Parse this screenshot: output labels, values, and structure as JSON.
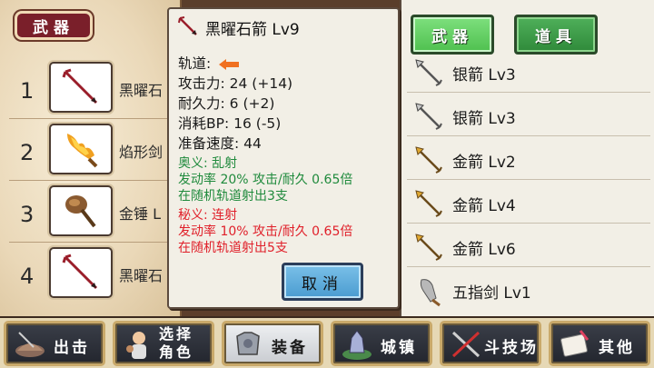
{
  "left_panel": {
    "tab_label": "武器",
    "slots": [
      {
        "number": "1",
        "name": "黑曜石",
        "icon": "obsidian-arrow-icon"
      },
      {
        "number": "2",
        "name": "焰形剑",
        "icon": "flame-sword-icon"
      },
      {
        "number": "3",
        "name": "金锤 L",
        "icon": "gold-hammer-icon"
      },
      {
        "number": "4",
        "name": "黑曜石",
        "icon": "obsidian-arrow-icon"
      }
    ]
  },
  "detail": {
    "title": "黑曜石箭 Lv9",
    "track_label": "轨道:",
    "stats": [
      "攻击力: 24 (+14)",
      "耐久力: 6 (+2)",
      "消耗BP: 16 (-5)",
      "准备速度: 44"
    ],
    "secret1": {
      "name": "奥义: 乱射",
      "rate": "发动率 20%  攻击/耐久 0.65倍",
      "desc": "在随机轨道射出3支"
    },
    "secret2": {
      "name": "秘义: 连射",
      "rate": "发动率 10%   攻击/耐久 0.65倍",
      "desc": "在随机轨道射出5支"
    },
    "cancel_label": "取消"
  },
  "right_panel": {
    "tabs": {
      "weapon": "武器",
      "item": "道具"
    },
    "items": [
      {
        "name": "银箭 Lv3",
        "icon": "silver-arrow-icon"
      },
      {
        "name": "银箭 Lv3",
        "icon": "silver-arrow-icon"
      },
      {
        "name": "金箭 Lv2",
        "icon": "gold-arrow-icon"
      },
      {
        "name": "金箭 Lv4",
        "icon": "gold-arrow-icon"
      },
      {
        "name": "金箭 Lv6",
        "icon": "gold-arrow-icon"
      },
      {
        "name": "五指剑 Lv1",
        "icon": "five-finger-sword-icon"
      }
    ]
  },
  "bottom_nav": [
    {
      "label": "出击",
      "icon": "sortie-icon"
    },
    {
      "label_line1": "选择",
      "label_line2": "角色",
      "icon": "select-character-icon"
    },
    {
      "label": "装备",
      "icon": "armor-icon",
      "active": true
    },
    {
      "label": "城镇",
      "icon": "town-icon"
    },
    {
      "label": "斗技场",
      "icon": "arena-icon"
    },
    {
      "label": "其他",
      "icon": "other-icon"
    }
  ],
  "colors": {
    "accent_green": "#1f8a3c",
    "accent_red": "#e0202a",
    "tab_red": "#7a1f2a",
    "cancel_blue": "#4a9bd0"
  }
}
